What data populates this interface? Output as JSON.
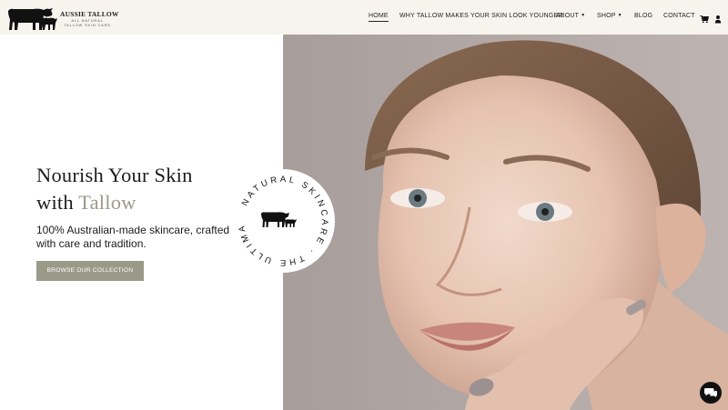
{
  "logo": {
    "title": "AUSSIE TALLOW",
    "subtitle_line1": "ALL NATURAL",
    "subtitle_line2": "TALLOW SKIN CARE"
  },
  "nav": {
    "items": [
      {
        "label": "HOME",
        "active": true
      },
      {
        "label": "WHY TALLOW MAKES YOUR SKIN LOOK YOUNGER"
      },
      {
        "label": "ABOUT",
        "dropdown": true
      },
      {
        "label": "SHOP",
        "dropdown": true
      },
      {
        "label": "BLOG"
      },
      {
        "label": "CONTACT"
      }
    ],
    "cart_icon": "cart-icon",
    "account_icon": "user-icon"
  },
  "hero": {
    "title_line1": "Nourish Your Skin",
    "title_line2_prefix": "with ",
    "title_line2_accent": "Tallow",
    "subtitle": "100% Australian-made skincare, crafted with care and tradition.",
    "cta_label": "BROWSE OUR COLLECTION"
  },
  "badge": {
    "ring_text": "NATURAL SKINCARE · THE ULTIMATE",
    "icon": "cow-and-calf-icon"
  },
  "chat": {
    "icon": "chat-icon"
  },
  "colors": {
    "header_bg": "#f7f4ee",
    "accent": "#9a9a86",
    "button_bg": "#9a9a89",
    "text": "#1c1c1c"
  }
}
